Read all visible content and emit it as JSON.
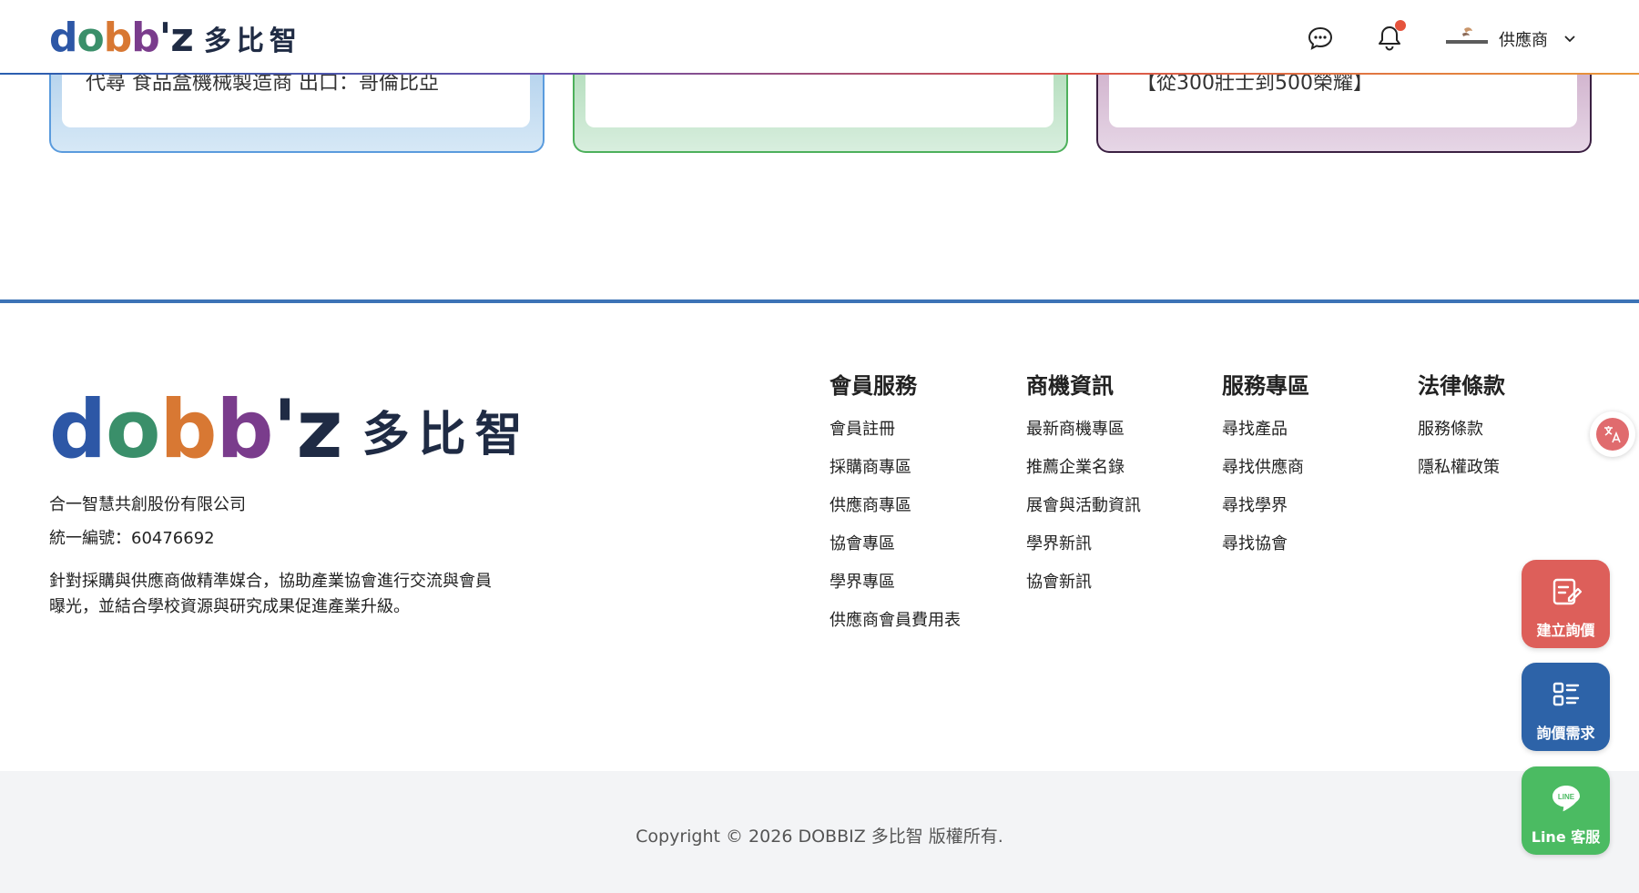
{
  "header": {
    "logo_text_cn": "多比智",
    "role_label": "供應商"
  },
  "cards": [
    {
      "text": "代尋 食品盒機械製造商 出口：哥倫比亞"
    },
    {
      "text": ""
    },
    {
      "text": "【從300壯士到500榮耀】"
    }
  ],
  "footer": {
    "logo_text_cn": "多比智",
    "company_name": "合一智慧共創股份有限公司",
    "tax_id": "統一編號：60476692",
    "description": "針對採購與供應商做精準媒合，協助產業協會進行交流與會員曝光，並結合學校資源與研究成果促進產業升級。",
    "columns": [
      {
        "title": "會員服務",
        "links": [
          "會員註冊",
          "採購商專區",
          "供應商專區",
          "協會專區",
          "學界專區",
          "供應商會員費用表"
        ]
      },
      {
        "title": "商機資訊",
        "links": [
          "最新商機專區",
          "推薦企業名錄",
          "展會與活動資訊",
          "學界新訊",
          "協會新訊"
        ]
      },
      {
        "title": "服務專區",
        "links": [
          "尋找產品",
          "尋找供應商",
          "尋找學界",
          "尋找協會"
        ]
      },
      {
        "title": "法律條款",
        "links": [
          "服務條款",
          "隱私權政策"
        ]
      }
    ],
    "copyright": "Copyright © 2026 DOBBIZ 多比智 版權所有."
  },
  "floating": {
    "create_quote": "建立詢價",
    "quote_needs": "詢價需求",
    "line_service": "Line 客服",
    "line_icon_text": "LINE"
  },
  "colors": {
    "accent_blue": "#2d63a8",
    "accent_red": "#dd5f5a",
    "accent_green": "#4bbb62"
  }
}
